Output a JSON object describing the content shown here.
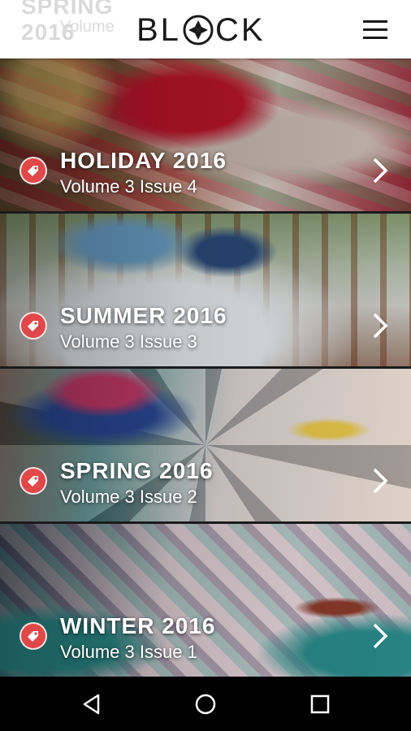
{
  "header": {
    "logo_text_left": "BL",
    "logo_text_right": "CK",
    "ghost_title": "SPRING 2016",
    "ghost_subtitle": "Volume"
  },
  "issues": [
    {
      "season": "HOLIDAY 2016",
      "volume": "Volume 3 Issue 4"
    },
    {
      "season": "SUMMER 2016",
      "volume": "Volume 3 Issue 3"
    },
    {
      "season": "SPRING 2016",
      "volume": "Volume 3 Issue 2"
    },
    {
      "season": "WINTER 2016",
      "volume": "Volume 3 Issue 1"
    }
  ],
  "icons": {
    "tag": "price-tag-icon",
    "chevron": "chevron-right-icon",
    "menu": "hamburger-menu-icon",
    "nav_back": "triangle-back-icon",
    "nav_home": "circle-home-icon",
    "nav_recents": "square-recents-icon"
  },
  "colors": {
    "tag_red": "#e0484a",
    "header_bg": "#ffffff",
    "nav_bg": "#000000"
  }
}
